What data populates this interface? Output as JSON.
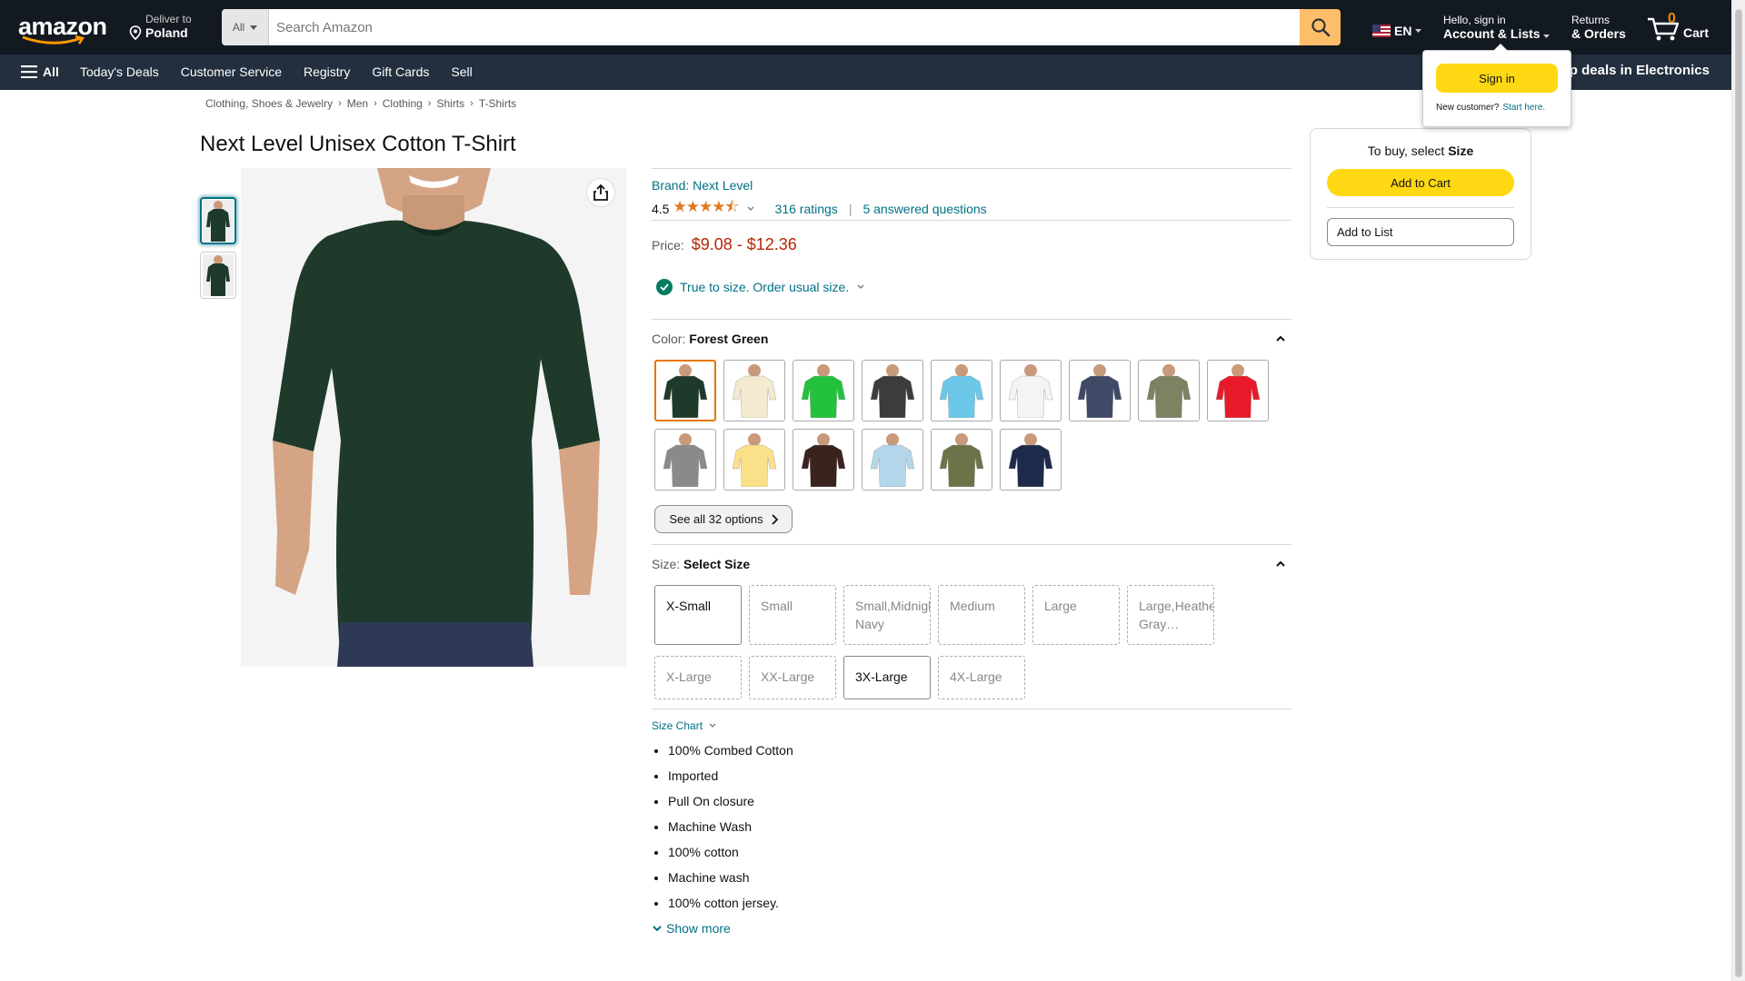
{
  "header": {
    "logo_text": "amazon",
    "deliver_line1": "Deliver to",
    "deliver_line2": "Poland",
    "search_category": "All",
    "search_placeholder": "Search Amazon",
    "language": "EN",
    "account_line1": "Hello, sign in",
    "account_line2": "Account & Lists",
    "returns_line1": "Returns",
    "returns_line2": "& Orders",
    "cart_count": "0",
    "cart_label": "Cart"
  },
  "subnav": {
    "all_label": "All",
    "links": [
      "Today's Deals",
      "Customer Service",
      "Registry",
      "Gift Cards",
      "Sell"
    ],
    "promo": "Shop deals in Electronics"
  },
  "signin_flyout": {
    "button": "Sign in",
    "new_customer": "New customer?",
    "start_here": "Start here."
  },
  "breadcrumb": [
    "Clothing, Shoes & Jewelry",
    "Men",
    "Clothing",
    "Shirts",
    "T-Shirts"
  ],
  "product": {
    "title": "Next Level Unisex Cotton T-Shirt",
    "brand": "Brand: Next Level",
    "rating_value": "4.5",
    "ratings_count": "316 ratings",
    "answered": "5 answered questions",
    "price_label": "Price:",
    "price_range": "$9.08 - $12.36",
    "fit_text": "True to size. Order usual size.",
    "color_label": "Color:",
    "color_selected": "Forest Green",
    "swatch_colors": [
      "#1e3a2a",
      "#f3ead0",
      "#22c23c",
      "#3c3c3e",
      "#6cc8e8",
      "#f4f4f4",
      "#3e4a66",
      "#7c8262",
      "#e81a2a",
      "#8a8a88",
      "#fbe08a",
      "#3a221e",
      "#b4d6ea",
      "#6a7448",
      "#1e2a4a"
    ],
    "see_all": "See all 32 options",
    "size_label": "Size:",
    "size_selected": "Select Size",
    "sizes_row1": [
      {
        "label": "X-Small",
        "available": true
      },
      {
        "label": "Small",
        "available": false
      },
      {
        "label": "Small,Midnight Navy",
        "available": false
      },
      {
        "label": "Medium",
        "available": false
      },
      {
        "label": "Large",
        "available": false
      },
      {
        "label": "Large,Heather Gray…",
        "available": false
      }
    ],
    "sizes_row2": [
      {
        "label": "X-Large",
        "available": false
      },
      {
        "label": "XX-Large",
        "available": false
      },
      {
        "label": "3X-Large",
        "available": true
      },
      {
        "label": "4X-Large",
        "available": false
      }
    ],
    "size_chart": "Size Chart",
    "bullets": [
      "100% Combed Cotton",
      "Imported",
      "Pull On closure",
      "Machine Wash",
      "100% cotton",
      "Machine wash",
      "100% cotton jersey."
    ],
    "show_more": "Show more"
  },
  "buybox": {
    "prompt_prefix": "To buy, select",
    "prompt_bold": "Size",
    "add_to_cart": "Add to Cart",
    "add_to_list": "Add to List"
  },
  "colors": {
    "header_bg": "#131921",
    "subnav_bg": "#232f3e",
    "link": "#007185",
    "price": "#b12704",
    "button_yellow": "#ffd814",
    "search_orange": "#febd69",
    "selected_swatch_border": "#e77600",
    "shirt_main": "#1e3a2a"
  }
}
